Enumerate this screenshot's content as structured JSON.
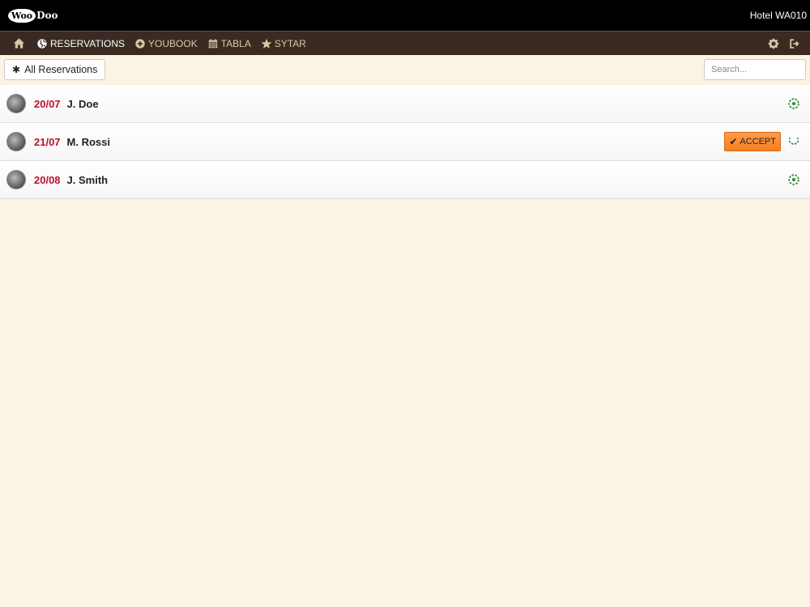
{
  "header": {
    "logo_badge": "Woo",
    "logo_rest": "Doo",
    "hotel_name": "Hotel WA010"
  },
  "nav": {
    "items": [
      {
        "label": "RESERVATIONS",
        "icon": "globe-icon",
        "active": true
      },
      {
        "label": "YOUBOOK",
        "icon": "plus-circle-icon",
        "active": false
      },
      {
        "label": "TABLA",
        "icon": "calendar-icon",
        "active": false
      },
      {
        "label": "SYTAR",
        "icon": "star-icon",
        "active": false
      }
    ],
    "right_icons": [
      "gear-icon",
      "logout-icon"
    ]
  },
  "toolbar": {
    "filter_label": "All Reservations",
    "search_placeholder": "Search..."
  },
  "reservations": [
    {
      "date": "20/07",
      "guest": "J. Doe",
      "action": null
    },
    {
      "date": "21/07",
      "guest": "M. Rossi",
      "action": "ACCEPT"
    },
    {
      "date": "20/08",
      "guest": "J. Smith",
      "action": null
    }
  ],
  "colors": {
    "date_red": "#c0102a",
    "accept_orange": "#f7801f",
    "status_green": "#2e8b3a",
    "nav_bg": "#3a2a22",
    "page_bg": "#fbf4e4"
  }
}
